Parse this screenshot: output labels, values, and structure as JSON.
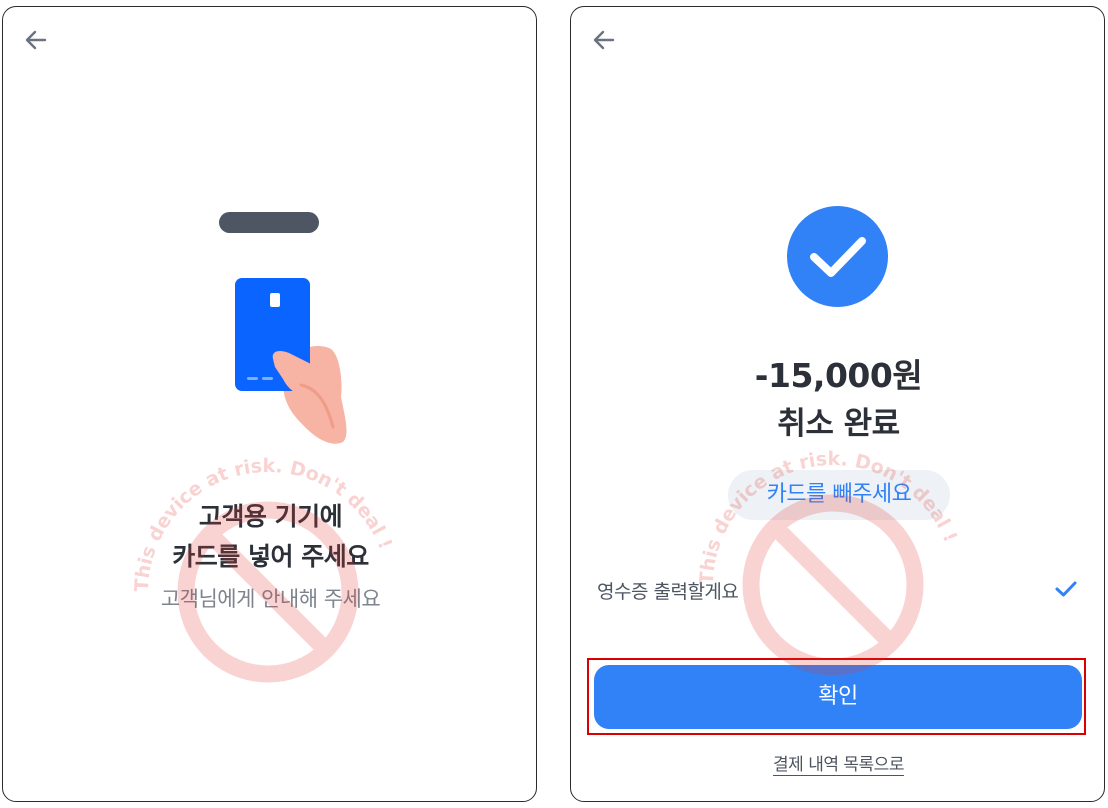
{
  "left_screen": {
    "back": {
      "icon": "arrow-left-icon"
    },
    "title_line1": "고객용 기기에",
    "title_line2": "카드를 넣어 주세요",
    "subtitle": "고객님에게 안내해 주세요",
    "illustration": {
      "icon": "hand-holding-card-icon"
    }
  },
  "right_screen": {
    "back": {
      "icon": "arrow-left-icon"
    },
    "status_icon": "check-circle-icon",
    "amount": "-15,000원",
    "status": "취소 완료",
    "notice": "카드를 빼주세요",
    "receipt_option": {
      "label": "영수증 출력할게요",
      "checked": true,
      "icon": "checkmark-icon"
    },
    "confirm_button": "확인",
    "history_link": "결제 내역 목록으로"
  },
  "watermark": {
    "text": "This device at risk. Don't deal !",
    "icon": "prohibited-icon"
  },
  "colors": {
    "accent": "#3182f6",
    "card_blue": "#0a64ff",
    "skin": "#f7b3a3",
    "slot": "#4d5662",
    "highlight_outline": "#d80000",
    "watermark": "#e53935"
  }
}
